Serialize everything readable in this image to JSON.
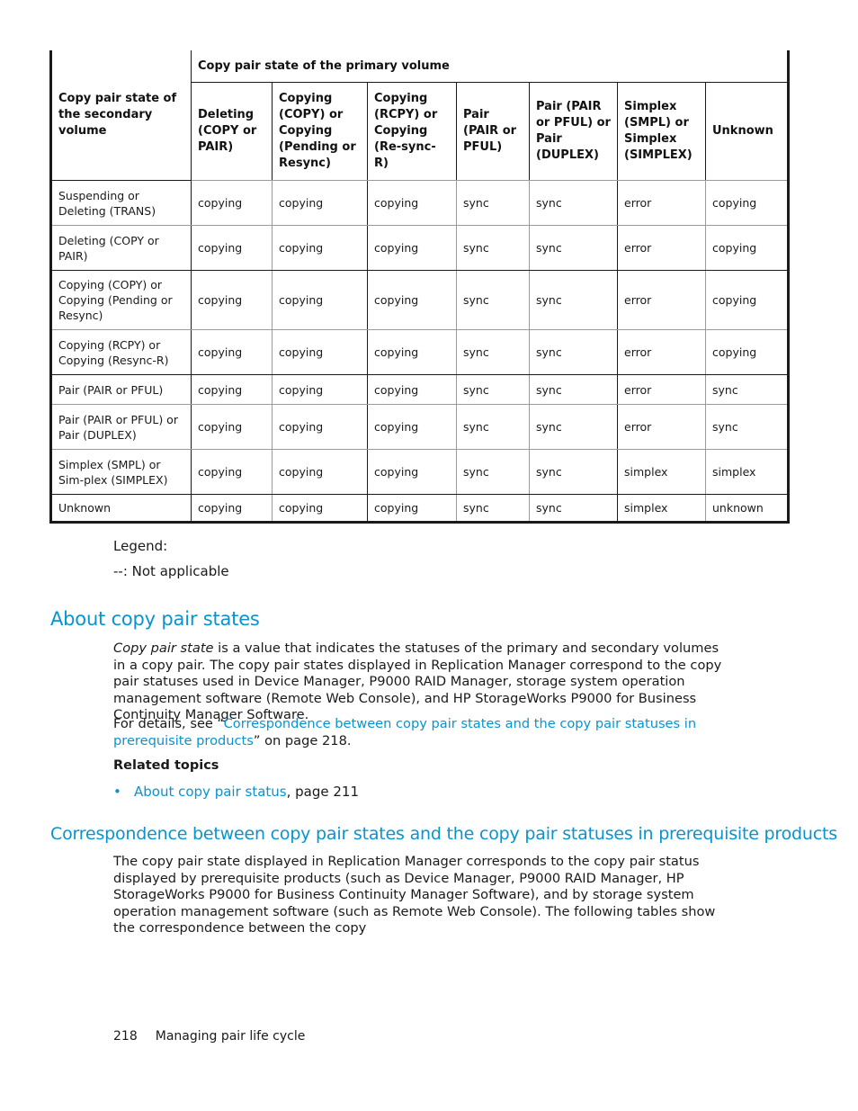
{
  "table": {
    "primary_header": "Copy pair state of the primary volume",
    "secondary_header": "Copy pair state of the secondary volume",
    "columns": [
      "Deleting (COPY or PAIR)",
      "Copying (COPY) or Copying (Pending or Resync)",
      "Copying (RCPY) or Copying (Re-sync-R)",
      "Pair (PAIR or PFUL)",
      "Pair (PAIR or PFUL) or Pair (DUPLEX)",
      "Simplex (SMPL) or Simplex (SIMPLEX)",
      "Unknown"
    ],
    "rows": [
      {
        "label": "Suspending or Deleting (TRANS)",
        "cells": [
          "copying",
          "copying",
          "copying",
          "sync",
          "sync",
          "error",
          "copying"
        ]
      },
      {
        "label": "Deleting (COPY or PAIR)",
        "cells": [
          "copying",
          "copying",
          "copying",
          "sync",
          "sync",
          "error",
          "copying"
        ]
      },
      {
        "label": "Copying (COPY) or Copying (Pending or Resync)",
        "cells": [
          "copying",
          "copying",
          "copying",
          "sync",
          "sync",
          "error",
          "copying"
        ]
      },
      {
        "label": "Copying (RCPY) or Copying (Resync-R)",
        "cells": [
          "copying",
          "copying",
          "copying",
          "sync",
          "sync",
          "error",
          "copying"
        ]
      },
      {
        "label": "Pair (PAIR or PFUL)",
        "cells": [
          "copying",
          "copying",
          "copying",
          "sync",
          "sync",
          "error",
          "sync"
        ]
      },
      {
        "label": "Pair (PAIR or PFUL) or Pair (DUPLEX)",
        "cells": [
          "copying",
          "copying",
          "copying",
          "sync",
          "sync",
          "error",
          "sync"
        ]
      },
      {
        "label": "Simplex (SMPL) or Sim-plex (SIMPLEX)",
        "cells": [
          "copying",
          "copying",
          "copying",
          "sync",
          "sync",
          "simplex",
          "simplex"
        ]
      },
      {
        "label": "Unknown",
        "cells": [
          "copying",
          "copying",
          "copying",
          "sync",
          "sync",
          "simplex",
          "unknown"
        ]
      }
    ]
  },
  "legend": {
    "title": "Legend:",
    "item": "--: Not applicable"
  },
  "section1": {
    "heading": "About copy pair states",
    "para1_term": "Copy pair state",
    "para1_rest": " is a value that indicates the statuses of the primary and secondary volumes in a copy pair. The copy pair states displayed in Replication Manager correspond to the copy pair statuses used in Device Manager, P9000 RAID Manager, storage system operation management software (Remote Web Console), and HP StorageWorks P9000 for Business Continuity Manager Software.",
    "para2_prefix": "For details, see “",
    "para2_link": "Correspondence between copy pair states and the copy pair statuses in prerequisite products",
    "para2_suffix": "” on page 218.",
    "related_title": "Related topics",
    "related": [
      {
        "link": "About copy pair status",
        "suffix": ", page 211"
      }
    ]
  },
  "section2": {
    "heading": "Correspondence between copy pair states and the copy pair statuses in prerequisite products",
    "para": "The copy pair state displayed in Replication Manager corresponds to the copy pair status displayed by prerequisite products (such as Device Manager, P9000 RAID Manager, HP StorageWorks P9000 for Business Continuity Manager Software), and by storage system operation management software (such as Remote Web Console). The following tables show the correspondence between the copy"
  },
  "footer": {
    "page_number": "218",
    "chapter": "Managing pair life cycle"
  },
  "colors": {
    "heading_blue": "#0a93cf",
    "link_blue": "#0a93cf"
  }
}
